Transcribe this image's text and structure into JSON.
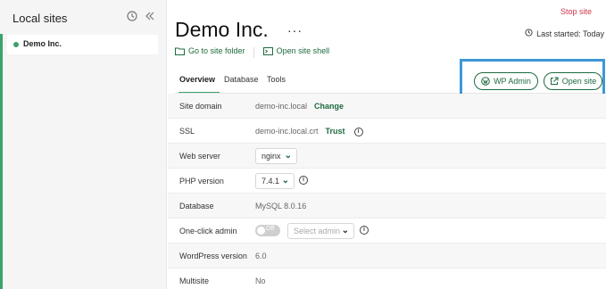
{
  "sidebar": {
    "title": "Local sites",
    "sites": [
      {
        "name": "Demo Inc.",
        "status_color": "#3aa36b"
      }
    ]
  },
  "header": {
    "site_title": "Demo Inc.",
    "stop_site": "Stop site",
    "last_started": "Last started: Today",
    "go_to_folder": "Go to site folder",
    "open_shell": "Open site shell"
  },
  "tabs": [
    "Overview",
    "Database",
    "Tools"
  ],
  "actions": {
    "wp_admin": "WP Admin",
    "open_site": "Open site"
  },
  "rows": {
    "site_domain": {
      "label": "Site domain",
      "value": "demo-inc.local",
      "action": "Change"
    },
    "ssl": {
      "label": "SSL",
      "value": "demo-inc.local.crt",
      "action": "Trust"
    },
    "web_server": {
      "label": "Web server",
      "value": "nginx"
    },
    "php_version": {
      "label": "PHP version",
      "value": "7.4.1"
    },
    "database": {
      "label": "Database",
      "value": "MySQL 8.0.16"
    },
    "one_click_admin": {
      "label": "One-click admin",
      "toggle": "Off",
      "placeholder": "Select admin"
    },
    "wordpress_version": {
      "label": "WordPress version",
      "value": "6.0"
    },
    "multisite": {
      "label": "Multisite",
      "value": "No"
    }
  },
  "colors": {
    "accent": "#3aa36b",
    "link": "#1d6b3f",
    "danger": "#d1364a",
    "highlight": "#3d97d8"
  },
  "icons": [
    "history-icon",
    "collapse-icon",
    "folder-icon",
    "terminal-icon",
    "clock-icon",
    "wordpress-icon",
    "external-link-icon",
    "info-icon",
    "chevron-down-icon"
  ]
}
